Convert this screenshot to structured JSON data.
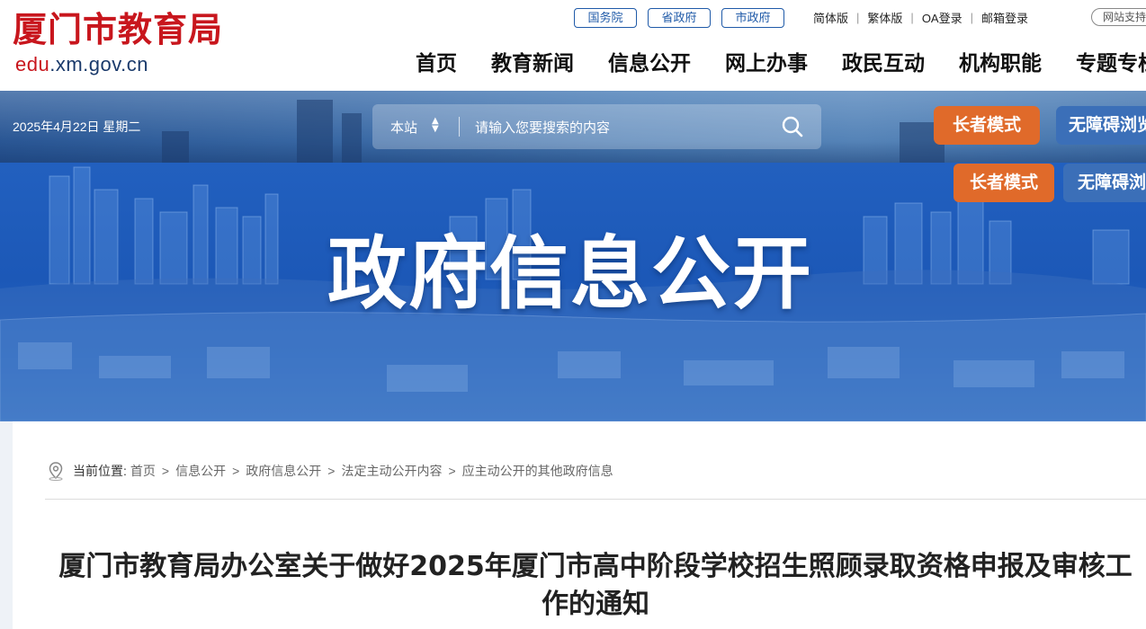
{
  "header": {
    "logo_cn": "厦门市教育局",
    "logo_en_prefix": "edu",
    "logo_en_suffix": ".xm.gov.cn",
    "gov_links": [
      "国务院",
      "省政府",
      "市政府"
    ],
    "util_links": [
      "简体版",
      "繁体版",
      "OA登录",
      "邮箱登录"
    ],
    "support": "网站支持",
    "nav": [
      "首页",
      "教育新闻",
      "信息公开",
      "网上办事",
      "政民互动",
      "机构职能",
      "专题专栏"
    ]
  },
  "toolbar": {
    "date": "2025年4月22日 星期二",
    "search_scope": "本站",
    "search_placeholder": "请输入您要搜索的内容",
    "elder_mode": "长者模式",
    "accessible": "无障碍浏览"
  },
  "banner": {
    "title": "政府信息公开",
    "elder_mode": "长者模式",
    "accessible": "无障碍浏览"
  },
  "breadcrumb": {
    "label": "当前位置:",
    "items": [
      "首页",
      "信息公开",
      "政府信息公开",
      "法定主动公开内容",
      "应主动公开的其他政府信息"
    ]
  },
  "article": {
    "title": "厦门市教育局办公室关于做好2025年厦门市高中阶段学校招生照顾录取资格申报及审核工作的通知"
  },
  "colors": {
    "brand_red": "#c8161d",
    "accent_blue": "#1f5aa8",
    "elder_orange": "#e06a2a",
    "banner_blue": "#1c58b7"
  }
}
